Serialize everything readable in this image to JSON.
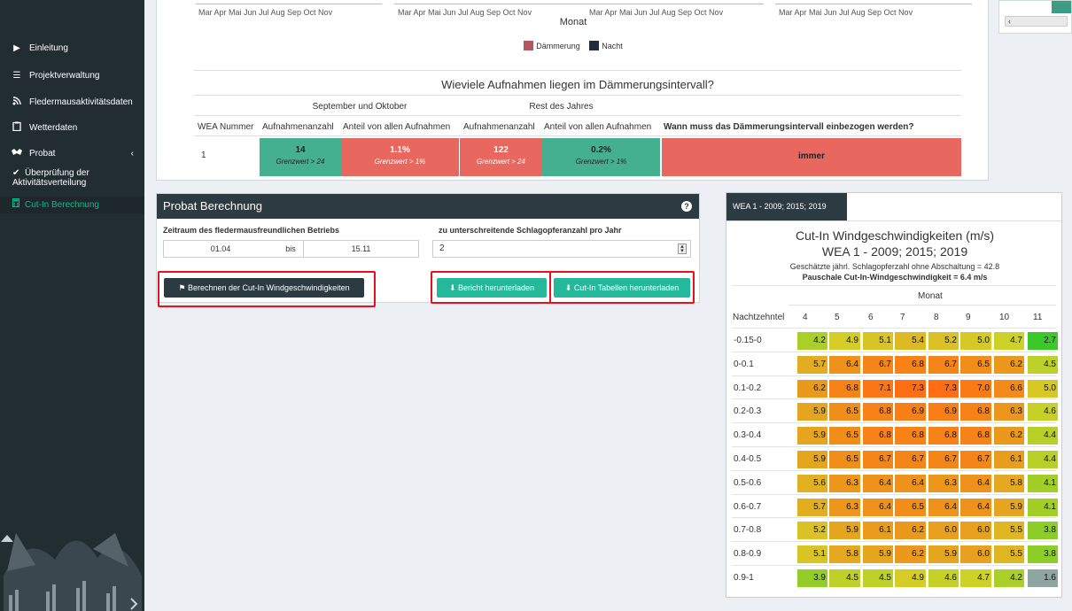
{
  "sidebar": {
    "items": [
      {
        "label": "Einleitung",
        "icon": "play-icon"
      },
      {
        "label": "Projektverwaltung",
        "icon": "sliders-icon"
      },
      {
        "label": "Fledermausaktivitätsdaten",
        "icon": "rss-icon"
      },
      {
        "label": "Wetterdaten",
        "icon": "clipboard-icon"
      },
      {
        "label": "Probat",
        "icon": "bat-icon",
        "chevron": "‹"
      }
    ],
    "subitems": [
      {
        "label_line1": "Überprüfung der",
        "label_line2": "Aktivitätsverteilung",
        "icon": "check-icon"
      },
      {
        "label": "Cut-In Berechnung",
        "icon": "calculator-icon"
      }
    ]
  },
  "chart_top": {
    "months": "Mar  Apr  Mai  Jun  Jul  Aug  Sep  Oct  Nov",
    "axis_title": "Monat",
    "legend": [
      {
        "label": "Dämmerung",
        "color": "#b05861"
      },
      {
        "label": "Nacht",
        "color": "#1f2d3d"
      }
    ]
  },
  "dusk_table": {
    "title": "Wieviele Aufnahmen liegen im Dämmerungsintervall?",
    "group1": "September und Oktober",
    "group2": "Rest des Jahres",
    "headers": [
      "WEA Nummer",
      "Aufnahmenanzahl",
      "Anteil von allen Aufnahmen",
      "Aufnahmenanzahl",
      "Anteil von allen Aufnahmen",
      "Wann muss das Dämmerungsintervall einbezogen werden?"
    ],
    "row": {
      "wea": "1",
      "c1": {
        "value": "14",
        "sub": "Grenzwert > 24"
      },
      "c2": {
        "value": "1.1%",
        "sub": "Grenzwert > 1%"
      },
      "c3": {
        "value": "122",
        "sub": "Grenzwert > 24"
      },
      "c4": {
        "value": "0.2%",
        "sub": "Grenzwert > 1%"
      },
      "c5": {
        "value": "immer"
      }
    }
  },
  "scroll_stub": {
    "arrow": "‹"
  },
  "probat": {
    "title": "Probat Berechnung",
    "help": "?",
    "period_label": "Zeitraum des fledermausfreundlichen Betriebs",
    "from": "01.04",
    "bis": "bis",
    "to": "15.11",
    "victims_label": "zu unterschreitende Schlagopferanzahl pro Jahr",
    "victims_value": "2",
    "calc_button": "Berechnen der Cut-In Windgeschwindigkeiten",
    "report_button": "Bericht herunterladen",
    "tables_button": "Cut-In Tabellen herunterladen"
  },
  "cutin": {
    "tab": "WEA 1 - 2009; 2015; 2019",
    "title": "Cut-In Windgeschwindigkeiten (m/s)",
    "subtitle": "WEA 1 - 2009; 2015; 2019",
    "note1": "Geschätzte jährl. Schlagopferzahl ohne Abschaltung = 42.8",
    "note2": "Pauschale Cut-In-Windgeschwindigkeit = 6.4 m/s",
    "col_group": "Monat",
    "row_header": "Nachtzehntel",
    "months": [
      "4",
      "5",
      "6",
      "7",
      "8",
      "9",
      "10",
      "11"
    ],
    "rows": [
      {
        "label": "-0.15-0",
        "values": [
          "4.2",
          "4.9",
          "5.1",
          "5.4",
          "5.2",
          "5.0",
          "4.7",
          "2.7"
        ]
      },
      {
        "label": "0-0.1",
        "values": [
          "5.7",
          "6.4",
          "6.7",
          "6.8",
          "6.7",
          "6.5",
          "6.2",
          "4.5"
        ]
      },
      {
        "label": "0.1-0.2",
        "values": [
          "6.2",
          "6.8",
          "7.1",
          "7.3",
          "7.3",
          "7.0",
          "6.6",
          "5.0"
        ]
      },
      {
        "label": "0.2-0.3",
        "values": [
          "5.9",
          "6.5",
          "6.8",
          "6.9",
          "6.9",
          "6.8",
          "6.3",
          "4.6"
        ]
      },
      {
        "label": "0.3-0.4",
        "values": [
          "5.9",
          "6.5",
          "6.8",
          "6.8",
          "6.8",
          "6.8",
          "6.2",
          "4.4"
        ]
      },
      {
        "label": "0.4-0.5",
        "values": [
          "5.9",
          "6.5",
          "6.7",
          "6.7",
          "6.7",
          "6.7",
          "6.1",
          "4.4"
        ]
      },
      {
        "label": "0.5-0.6",
        "values": [
          "5.6",
          "6.3",
          "6.4",
          "6.4",
          "6.3",
          "6.4",
          "5.8",
          "4.1"
        ]
      },
      {
        "label": "0.6-0.7",
        "values": [
          "5.7",
          "6.3",
          "6.4",
          "6.5",
          "6.4",
          "6.4",
          "5.9",
          "4.1"
        ]
      },
      {
        "label": "0.7-0.8",
        "values": [
          "5.2",
          "5.9",
          "6.1",
          "6.2",
          "6.0",
          "6.0",
          "5.5",
          "3.8"
        ]
      },
      {
        "label": "0.8-0.9",
        "values": [
          "5.1",
          "5.8",
          "5.9",
          "6.2",
          "5.9",
          "6.0",
          "5.5",
          "3.8"
        ]
      },
      {
        "label": "0.9-1",
        "values": [
          "3.9",
          "4.5",
          "4.5",
          "4.9",
          "4.6",
          "4.7",
          "4.2",
          "1.6"
        ]
      }
    ]
  }
}
